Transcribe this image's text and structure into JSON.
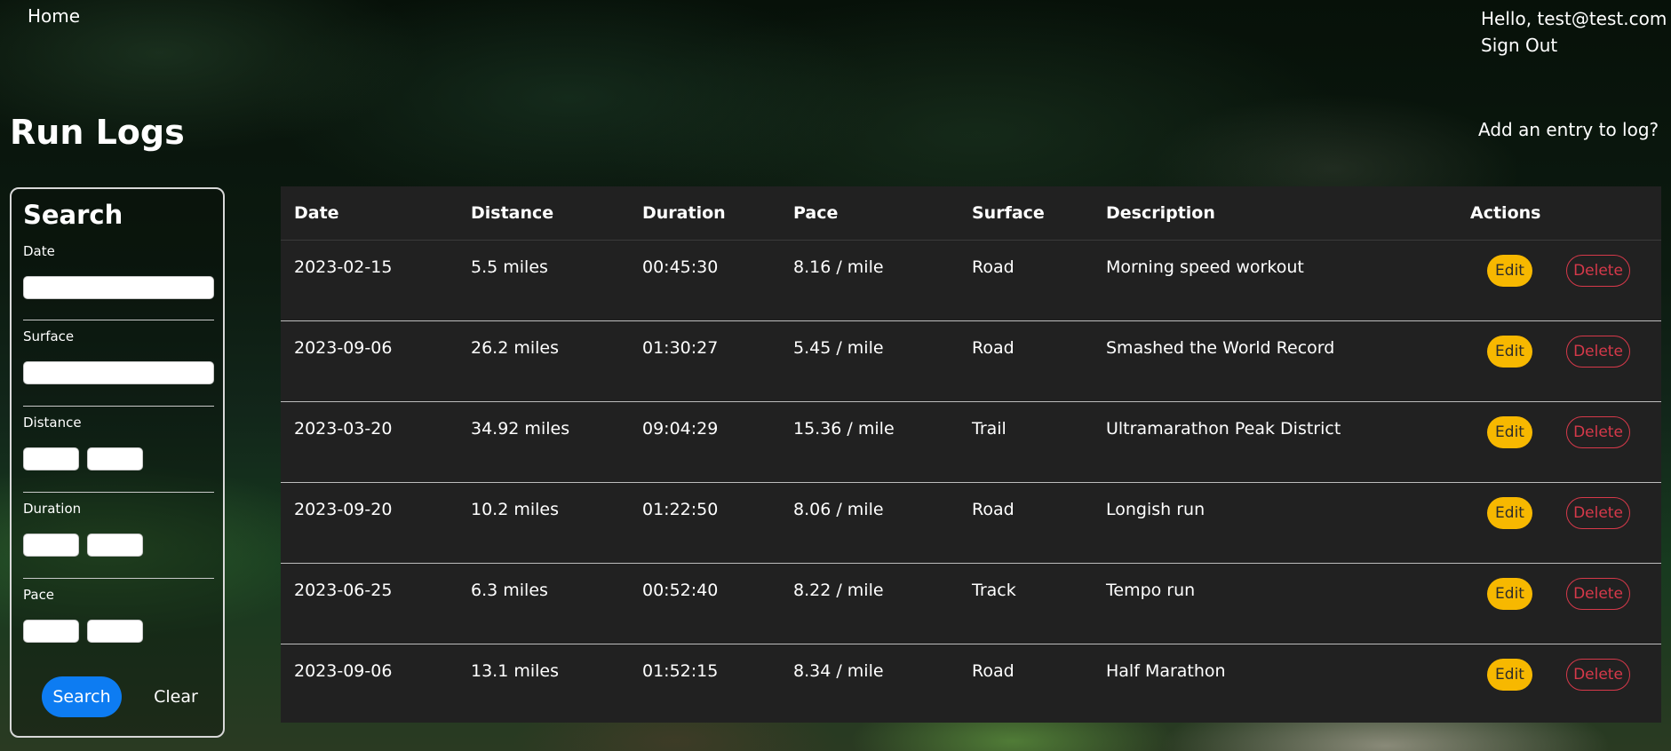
{
  "header": {
    "home_label": "Home",
    "greeting": "Hello, test@test.com",
    "sign_out_label": "Sign Out"
  },
  "page": {
    "title": "Run Logs",
    "add_entry_label": "Add an entry to log?"
  },
  "search": {
    "title": "Search",
    "date_label": "Date",
    "date_value": "",
    "surface_label": "Surface",
    "surface_value": "",
    "distance_label": "Distance",
    "distance_min": "",
    "distance_max": "",
    "duration_label": "Duration",
    "duration_min": "",
    "duration_max": "",
    "pace_label": "Pace",
    "pace_min": "",
    "pace_max": "",
    "search_button": "Search",
    "clear_button": "Clear"
  },
  "table": {
    "headers": {
      "date": "Date",
      "distance": "Distance",
      "duration": "Duration",
      "pace": "Pace",
      "surface": "Surface",
      "description": "Description",
      "actions": "Actions"
    },
    "edit_label": "Edit",
    "delete_label": "Delete",
    "rows": [
      {
        "date": "2023-02-15",
        "distance": "5.5 miles",
        "duration": "00:45:30",
        "pace": "8.16 / mile",
        "surface": "Road",
        "description": "Morning speed workout"
      },
      {
        "date": "2023-09-06",
        "distance": "26.2 miles",
        "duration": "01:30:27",
        "pace": "5.45 / mile",
        "surface": "Road",
        "description": "Smashed the World Record"
      },
      {
        "date": "2023-03-20",
        "distance": "34.92 miles",
        "duration": "09:04:29",
        "pace": "15.36 / mile",
        "surface": "Trail",
        "description": "Ultramarathon Peak District"
      },
      {
        "date": "2023-09-20",
        "distance": "10.2 miles",
        "duration": "01:22:50",
        "pace": "8.06 / mile",
        "surface": "Road",
        "description": "Longish run"
      },
      {
        "date": "2023-06-25",
        "distance": "6.3 miles",
        "duration": "00:52:40",
        "pace": "8.22 / mile",
        "surface": "Track",
        "description": "Tempo run"
      },
      {
        "date": "2023-09-06",
        "distance": "13.1 miles",
        "duration": "01:52:15",
        "pace": "8.34 / mile",
        "surface": "Road",
        "description": "Half Marathon"
      }
    ]
  },
  "colors": {
    "primary": "#0d7cf2",
    "warning": "#f7b800",
    "danger": "#d6394a",
    "table_bg": "#212121"
  }
}
